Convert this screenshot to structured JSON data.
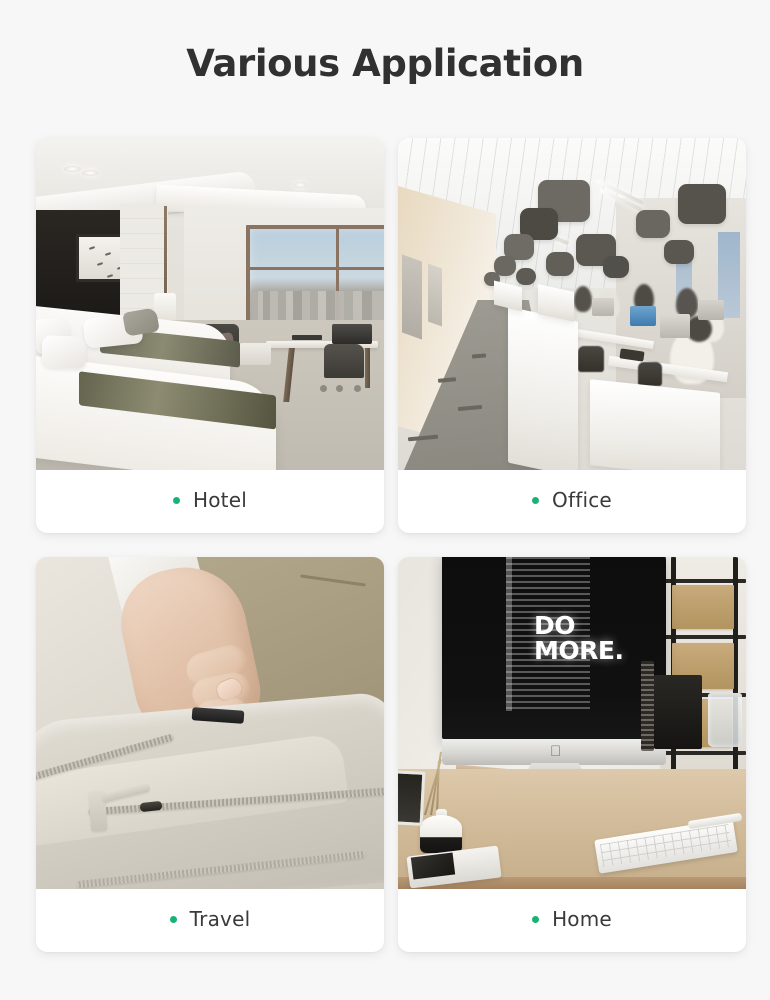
{
  "page": {
    "title": "Various Application",
    "background_color": "#f7f7f7",
    "title_color": "#313131",
    "accent_color": "#18b277"
  },
  "cards": [
    {
      "id": "hotel",
      "label": "Hotel",
      "bullet_icon": "green-dot-icon",
      "photo_alt": "Modern hotel room with two twin beds, dark headboard wall with framed bird artwork, floor-to-ceiling window showing a city skyline, and a work desk with laptop and chair"
    },
    {
      "id": "office",
      "label": "Office",
      "bullet_icon": "green-dot-icon",
      "photo_alt": "Open-plan office corridor with suspended dark acoustic ceiling panels, white partition cabinets, rows of desks with monitors and employees working"
    },
    {
      "id": "travel",
      "label": "Travel",
      "bullet_icon": "green-dot-icon",
      "photo_alt": "A hand holding a coiled black cable bundle fastened with a strap, placing it into the open zippered pocket of a light grey backpack, wearing khaki trousers"
    },
    {
      "id": "home",
      "label": "Home",
      "bullet_icon": "green-dot-icon",
      "photo_alt": "Home desk setup with an iMac on a wooden riser displaying DO MORE. on screen, white keyboard, reed diffuser and shelving in the background"
    }
  ],
  "home_screen": {
    "line1": "DO",
    "line2": "MORE."
  }
}
